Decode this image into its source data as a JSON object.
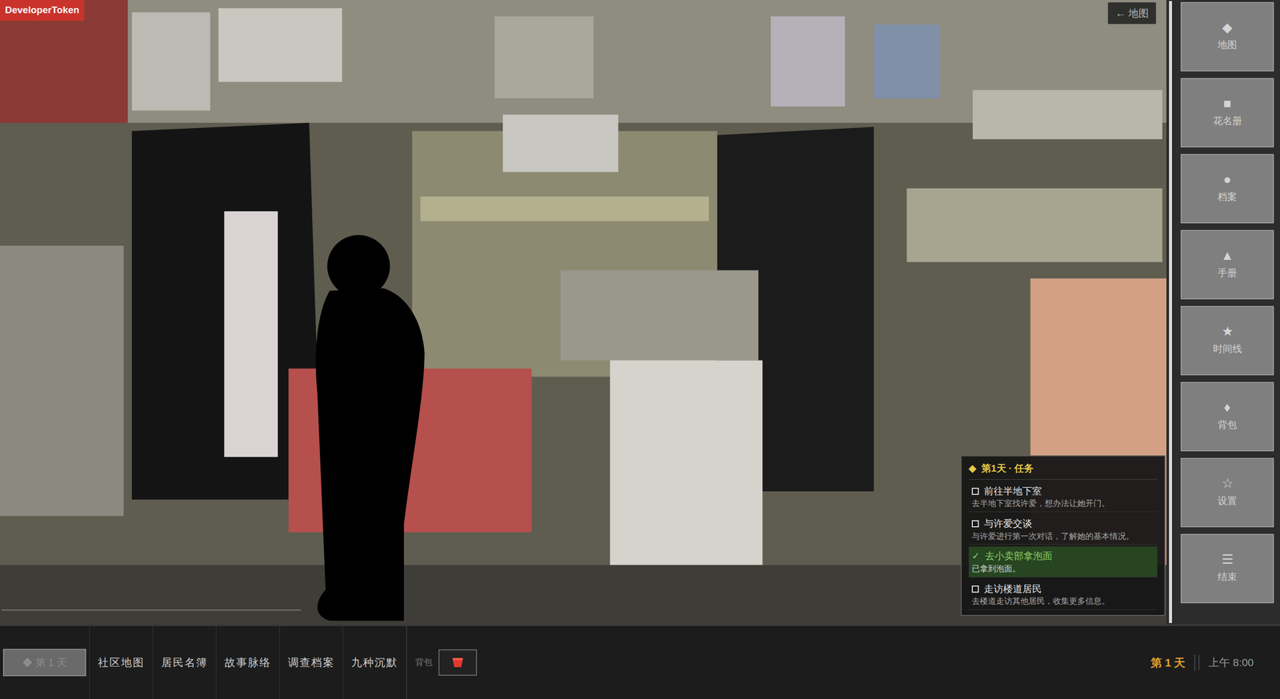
{
  "badge": "DeveloperToken",
  "back_button": "← 地图",
  "tasks": {
    "icon": "◆",
    "title": "第1天 · 任务",
    "items": [
      {
        "title": "前往半地下室",
        "desc": "去半地下室找许爱，想办法让她开门。",
        "done": false,
        "mark": ""
      },
      {
        "title": "与许爱交谈",
        "desc": "与许爱进行第一次对话，了解她的基本情况。",
        "done": false,
        "mark": ""
      },
      {
        "title": "去小卖部拿泡面",
        "desc": "已拿到泡面。",
        "done": true,
        "mark": "✓"
      },
      {
        "title": "走访楼道居民",
        "desc": "去楼道走访其他居民，收集更多信息。",
        "done": false,
        "mark": ""
      }
    ]
  },
  "sidebar": {
    "items": [
      {
        "icon": "◆",
        "label": "地图"
      },
      {
        "icon": "■",
        "label": "花名册"
      },
      {
        "icon": "●",
        "label": "档案"
      },
      {
        "icon": "▲",
        "label": "手册"
      },
      {
        "icon": "★",
        "label": "时间线"
      },
      {
        "icon": "♦",
        "label": "背包"
      },
      {
        "icon": "☆",
        "label": "设置"
      },
      {
        "icon": "☰",
        "label": "结束"
      }
    ]
  },
  "bottom_bar": {
    "day_button": {
      "label": "◆ 第 1 天",
      "disabled": true
    },
    "tabs": [
      "社区地图",
      "居民名簿",
      "故事脉络",
      "调查档案",
      "九种沉默"
    ],
    "bag_label": "背包",
    "day": "第 1 天",
    "time": "上午 8:00"
  }
}
